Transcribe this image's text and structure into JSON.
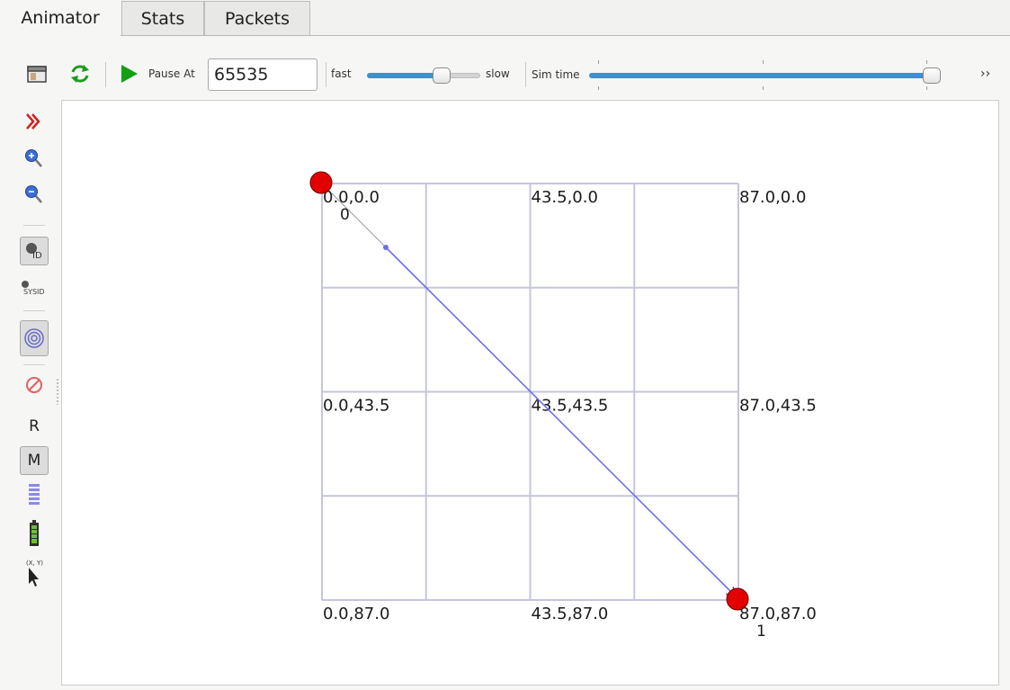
{
  "tabs": [
    {
      "label": "Animator",
      "active": true
    },
    {
      "label": "Stats",
      "active": false
    },
    {
      "label": "Packets",
      "active": false
    }
  ],
  "toolbar": {
    "pause_label": "Pause At",
    "pause_value": "65535",
    "speed_fast_label": "fast",
    "speed_slow_label": "slow",
    "speed_level": 0.75,
    "simtime_label": "Sim time",
    "simtime_level": 1.0,
    "more_glyph": "››",
    "icons": [
      "open-trace-icon",
      "reload-icon",
      "play-icon"
    ]
  },
  "sidebar": {
    "items": [
      {
        "icon": "chevron-right-double-icon"
      },
      {
        "icon": "zoom-in-icon"
      },
      {
        "icon": "zoom-out-icon"
      },
      {
        "icon": "node-id-icon",
        "pressed": true,
        "text": "ID"
      },
      {
        "icon": "node-sysid-icon",
        "text": "SYSID"
      },
      {
        "icon": "wireless-circles-icon",
        "pressed": true
      },
      {
        "icon": "no-entry-icon"
      },
      {
        "icon": "show-ipv4-button",
        "text": "R"
      },
      {
        "icon": "show-mac-button",
        "text": "M",
        "pressed": true
      },
      {
        "icon": "routing-table-icon"
      },
      {
        "icon": "battery-icon"
      },
      {
        "icon": "mouse-position-icon",
        "text": "(X, Y)"
      }
    ]
  },
  "grid": {
    "labels": [
      "0.0,0.0",
      "43.5,0.0",
      "87.0,0.0",
      "0.0,43.5",
      "43.5,43.5",
      "87.0,43.5",
      "0.0,87.0",
      "43.5,87.0",
      "87.0,87.0"
    ]
  },
  "nodes": [
    {
      "id": "0",
      "x": 0.0,
      "y": 0.0,
      "color": "#e30000"
    },
    {
      "id": "1",
      "x": 87.0,
      "y": 87.0,
      "color": "#e30000"
    }
  ],
  "packet": {
    "from": "0",
    "to": "1",
    "color": "#6f6fe8"
  },
  "colors": {
    "accent": "#3593d5",
    "grid": "#c5c5dc",
    "play": "#12a012"
  }
}
